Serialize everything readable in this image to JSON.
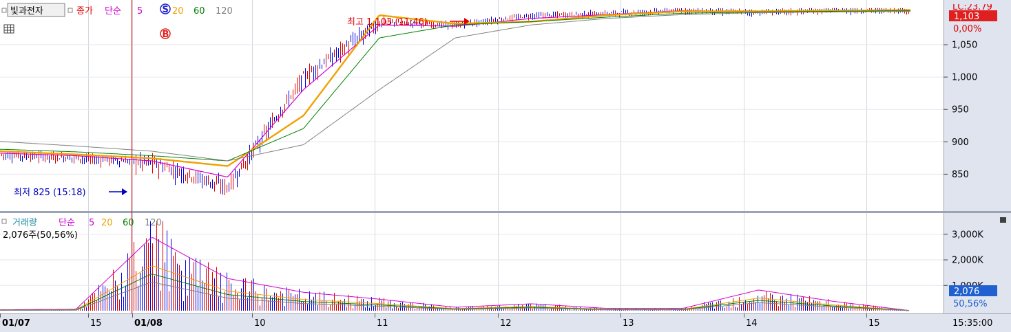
{
  "top_legend": {
    "stock_name": "빛과전자",
    "price_label": "종가",
    "ma_label": "단순",
    "periods": [
      "5",
      "20",
      "60",
      "120"
    ],
    "period_colors": [
      "#d000d0",
      "#f0a000",
      "#008000",
      "#808080"
    ]
  },
  "volume_legend": {
    "label": "거래량",
    "ma_label": "단순",
    "periods": [
      "5",
      "20",
      "60",
      "120"
    ],
    "current_text": "2,076주(50,56%)"
  },
  "colors": {
    "up": "#e00000",
    "down": "#0000e0",
    "ma5": "#d000d0",
    "ma20": "#f0a000",
    "ma60": "#008000",
    "ma120": "#808080",
    "axis_bg": "#dfe4ef",
    "price_badge": "#e02020",
    "volume_badge": "#2060d0"
  },
  "annotations": {
    "high_text": "최고 1,103 (11:46)",
    "low_text": "최저 825 (15:18)",
    "buy_marker": "B",
    "sell_marker": "S"
  },
  "price_axis": {
    "top_cut_label": "LC:23.79",
    "current_price": "1,103",
    "current_change": "0,00%"
  },
  "volume_axis": {
    "current_volume": "2,076",
    "current_ratio": "50,56%"
  },
  "time_axis": {
    "current_time": "15:35:00"
  },
  "chart_data": [
    {
      "type": "line",
      "title": "",
      "x": [
        "01/07",
        "15",
        "01/08",
        "10",
        "11",
        "12",
        "13",
        "14",
        "15"
      ],
      "ylabel": "",
      "yticks": [
        850,
        900,
        950,
        1000,
        1050
      ],
      "ylim": [
        800,
        1110
      ],
      "grid": true,
      "legend": "top-left",
      "series": [
        {
          "name": "종가",
          "values": [
            880,
            875,
            868,
            830,
            1000,
            1085,
            1080,
            1095,
            1098,
            1103,
            1100,
            1103,
            1103
          ]
        },
        {
          "name": "5",
          "values": [
            882,
            878,
            870,
            845,
            980,
            1080,
            1078,
            1090,
            1096,
            1102,
            1100,
            1102,
            1103
          ]
        },
        {
          "name": "20",
          "values": [
            885,
            880,
            874,
            862,
            940,
            1095,
            1082,
            1085,
            1095,
            1101,
            1101,
            1102,
            1103
          ]
        },
        {
          "name": "60",
          "values": [
            888,
            884,
            878,
            870,
            920,
            1060,
            1080,
            1085,
            1092,
            1098,
            1100,
            1101,
            1102
          ]
        },
        {
          "name": "120",
          "values": [
            900,
            893,
            885,
            870,
            895,
            980,
            1060,
            1080,
            1090,
            1096,
            1099,
            1100,
            1101
          ]
        }
      ],
      "annotations": [
        {
          "text": "최고 1,103 (11:46)",
          "value": 1103
        },
        {
          "text": "최저 825 (15:18)",
          "value": 825
        }
      ]
    },
    {
      "type": "bar",
      "title": "",
      "ylabel": "",
      "yticks": [
        "1,000K",
        "2,000K",
        "3,000K"
      ],
      "ylim": [
        0,
        3600
      ],
      "grid": true,
      "legend": "top-left",
      "series": [
        {
          "name": "거래량",
          "values": [
            40,
            60,
            3200,
            1400,
            800,
            500,
            150,
            300,
            100,
            100,
            900,
            400,
            2
          ]
        }
      ]
    }
  ]
}
